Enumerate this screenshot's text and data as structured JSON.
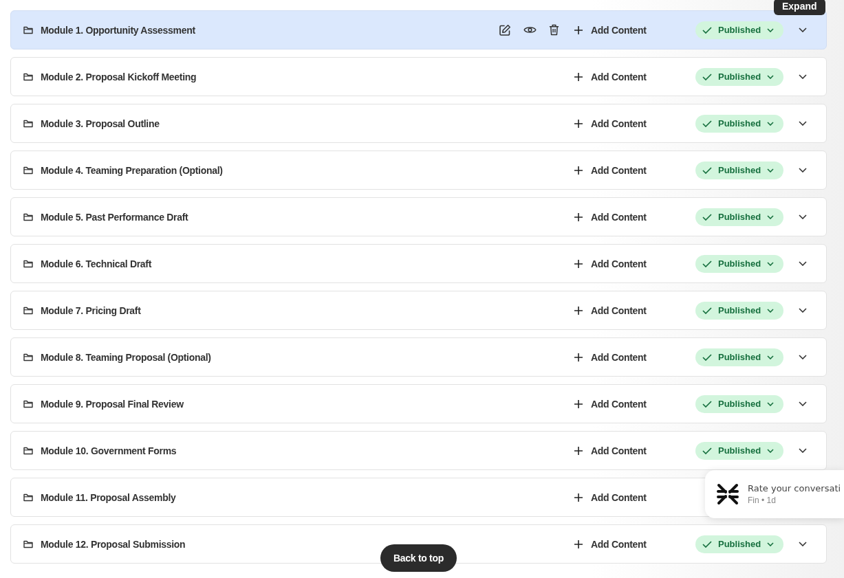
{
  "modules": [
    {
      "title": "Module 1. Opportunity Assessment",
      "selected": true,
      "add_label": "Add Content",
      "status": "Published",
      "expand_tooltip": "Expand"
    },
    {
      "title": "Module 2. Proposal Kickoff Meeting",
      "selected": false,
      "add_label": "Add Content",
      "status": "Published"
    },
    {
      "title": "Module 3. Proposal Outline",
      "selected": false,
      "add_label": "Add Content",
      "status": "Published"
    },
    {
      "title": "Module 4. Teaming Preparation (Optional)",
      "selected": false,
      "add_label": "Add Content",
      "status": "Published"
    },
    {
      "title": "Module 5. Past Performance Draft",
      "selected": false,
      "add_label": "Add Content",
      "status": "Published"
    },
    {
      "title": "Module 6. Technical Draft",
      "selected": false,
      "add_label": "Add Content",
      "status": "Published"
    },
    {
      "title": "Module 7. Pricing Draft",
      "selected": false,
      "add_label": "Add Content",
      "status": "Published"
    },
    {
      "title": "Module 8. Teaming Proposal (Optional)",
      "selected": false,
      "add_label": "Add Content",
      "status": "Published"
    },
    {
      "title": "Module 9. Proposal Final Review",
      "selected": false,
      "add_label": "Add Content",
      "status": "Published"
    },
    {
      "title": "Module 10. Government Forms",
      "selected": false,
      "add_label": "Add Content",
      "status": "Published"
    },
    {
      "title": "Module 11. Proposal Assembly",
      "selected": false,
      "add_label": "Add Content"
    },
    {
      "title": "Module 12. Proposal Submission",
      "selected": false,
      "add_label": "Add Content",
      "status": "Published"
    }
  ],
  "toast": {
    "message": "Rate your conversati",
    "meta": "Fin • 1d"
  },
  "back_to_top": "Back to top"
}
